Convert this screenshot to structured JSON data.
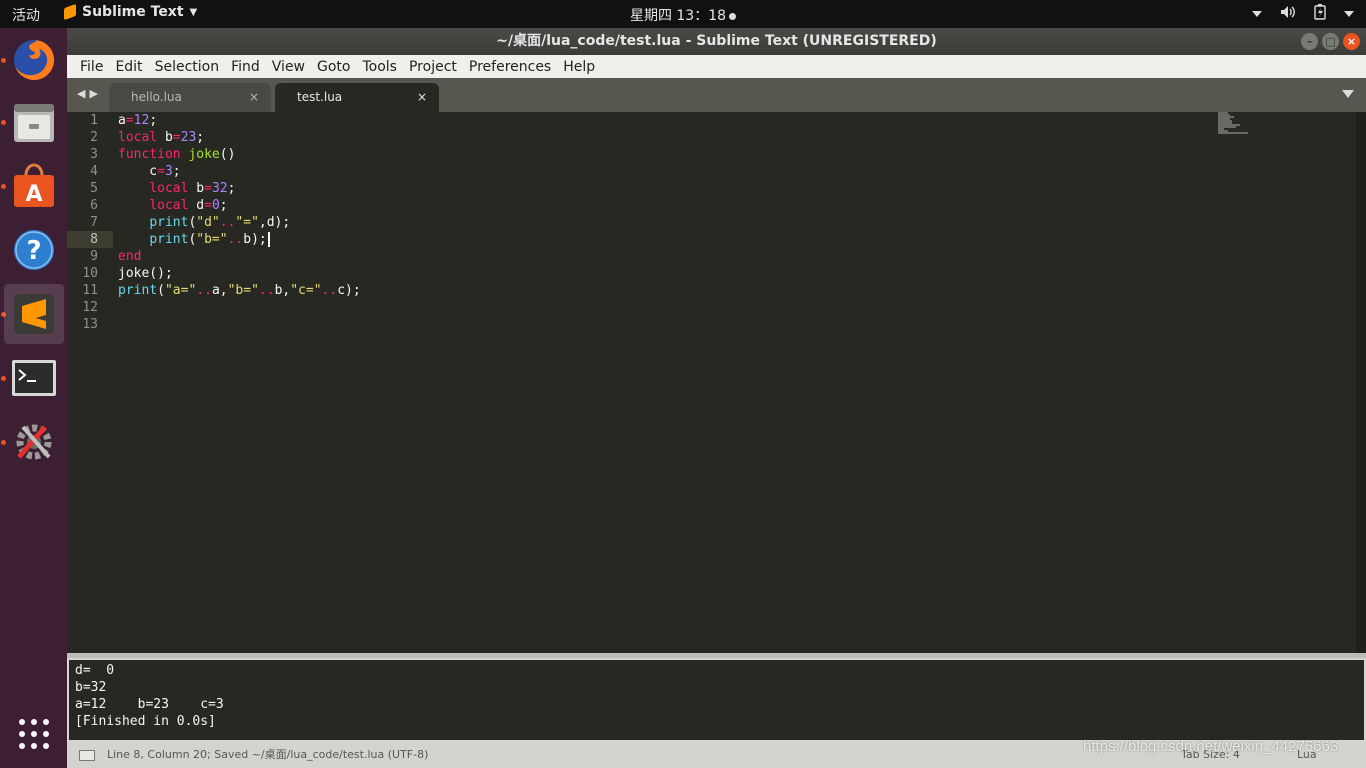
{
  "topbar": {
    "activities": "活动",
    "app_name": "Sublime Text",
    "clock": "星期四 13：18"
  },
  "dock": {
    "items": [
      {
        "name": "firefox",
        "icon": "firefox-icon",
        "running": true,
        "active": false
      },
      {
        "name": "files",
        "icon": "file-cabinet-icon",
        "running": true,
        "active": false
      },
      {
        "name": "software",
        "icon": "shopping-bag-icon",
        "running": true,
        "active": false
      },
      {
        "name": "help",
        "icon": "help-icon",
        "running": false,
        "active": false
      },
      {
        "name": "sublime-text",
        "icon": "sublime-logo-icon",
        "running": true,
        "active": true
      },
      {
        "name": "terminal",
        "icon": "terminal-icon",
        "running": true,
        "active": false
      },
      {
        "name": "settings",
        "icon": "settings-tools-icon",
        "running": true,
        "active": false
      }
    ],
    "show_apps_icon": "app-grid-icon"
  },
  "window": {
    "title": "~/桌面/lua_code/test.lua - Sublime Text (UNREGISTERED)"
  },
  "menu": [
    "File",
    "Edit",
    "Selection",
    "Find",
    "View",
    "Goto",
    "Tools",
    "Project",
    "Preferences",
    "Help"
  ],
  "tabs": [
    {
      "label": "hello.lua",
      "close": "×",
      "active": false
    },
    {
      "label": "test.lua",
      "close": "×",
      "active": true
    }
  ],
  "editor": {
    "current_line": 8,
    "line_numbers": [
      "1",
      "2",
      "3",
      "4",
      "5",
      "6",
      "7",
      "8",
      "9",
      "10",
      "11",
      "12",
      "13"
    ]
  },
  "output": {
    "lines": [
      "d=  0",
      "b=32",
      "a=12\tb=23\tc=3",
      "[Finished in 0.0s]"
    ]
  },
  "status": {
    "text": "Line 8, Column 20; Saved ~/桌面/lua_code/test.lua (UTF-8)",
    "tab_size": "Tab Size: 4",
    "syntax": "Lua"
  },
  "watermark": "https://blog.csdn.net/weixin_44275663",
  "colors": {
    "keyword": "#f92672",
    "number": "#ae81ff",
    "function_name": "#a6e22e",
    "builtin": "#66d9ef",
    "string": "#e6db74",
    "editor_bg": "#272822",
    "dock_bg": "#3c1f33",
    "running_dot": "#e95420"
  }
}
